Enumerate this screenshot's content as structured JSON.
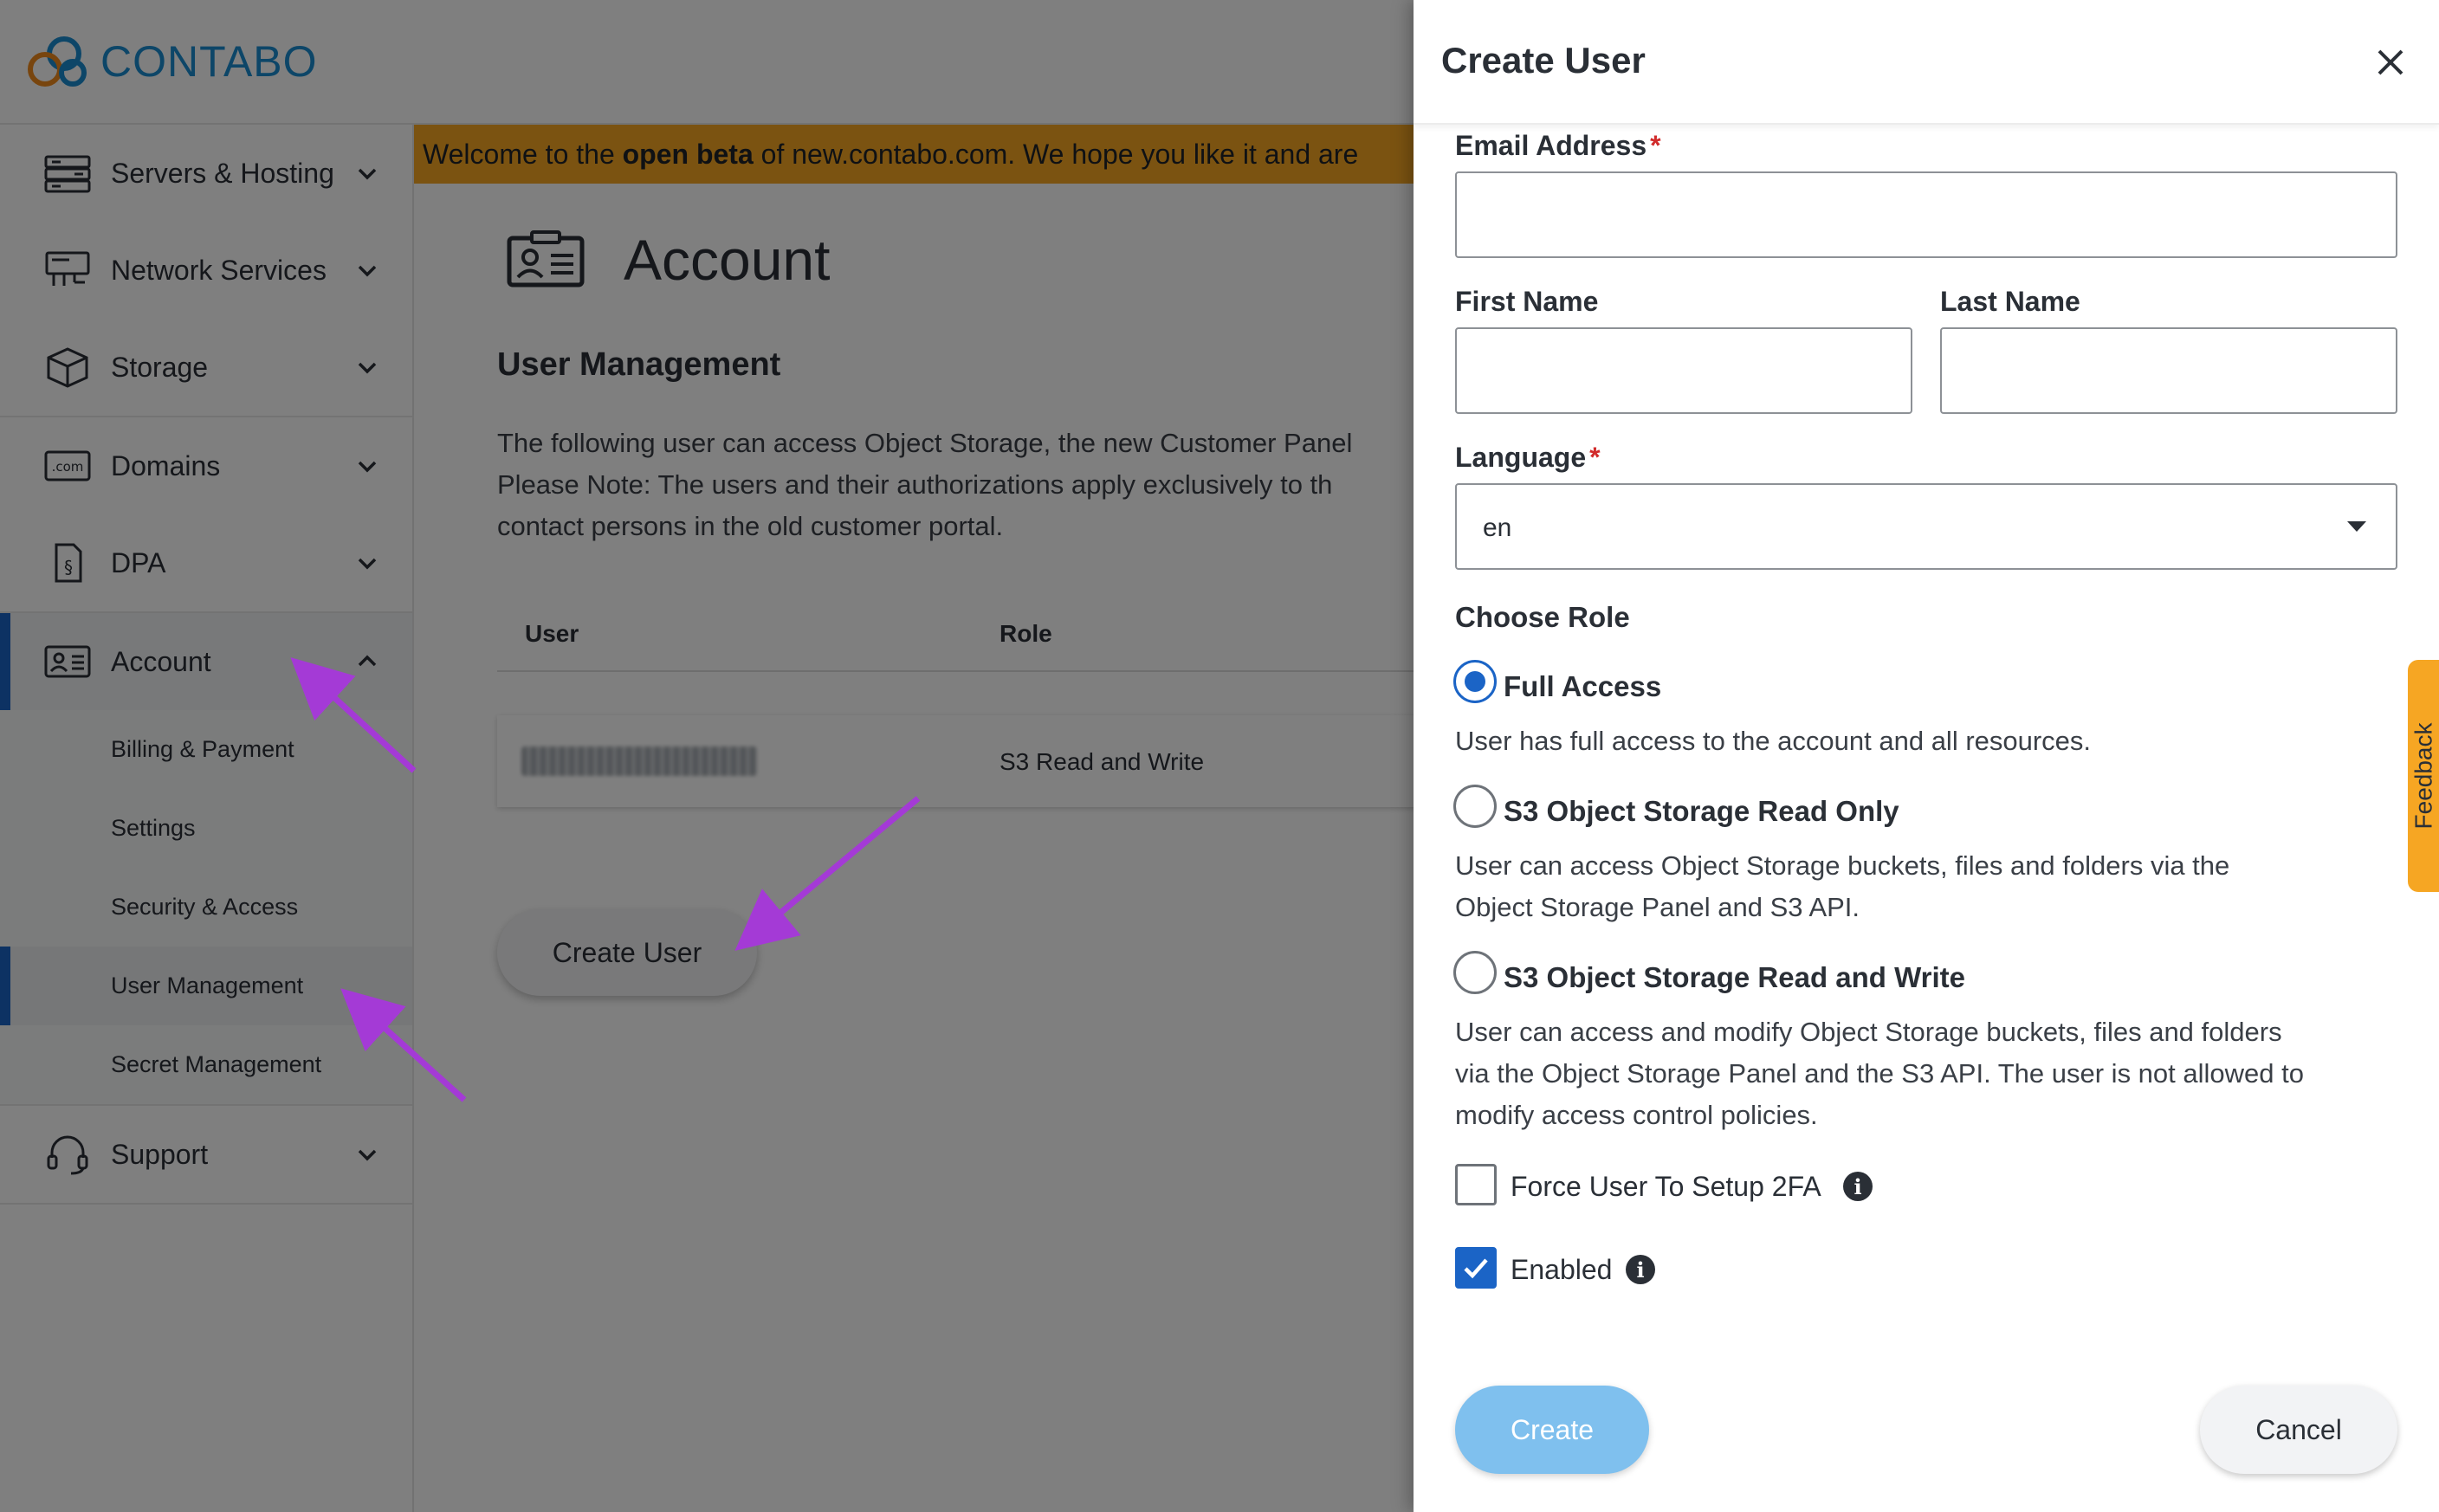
{
  "brand": {
    "name": "CONTABO",
    "color": "#1b8dd1"
  },
  "sidebar": {
    "groups": [
      {
        "label": "Servers & Hosting",
        "icon": "server-icon"
      },
      {
        "label": "Network Services",
        "icon": "network-icon"
      },
      {
        "label": "Storage",
        "icon": "box-icon"
      },
      {
        "label": "Domains",
        "icon": "domain-com-icon"
      },
      {
        "label": "DPA",
        "icon": "document-paragraph-icon"
      },
      {
        "label": "Account",
        "icon": "id-card-icon"
      },
      {
        "label": "Support",
        "icon": "headset-icon"
      }
    ],
    "account_sub": [
      "Billing & Payment",
      "Settings",
      "Security & Access",
      "User Management",
      "Secret Management"
    ]
  },
  "banner": {
    "pre": "Welcome to the ",
    "bold": "open beta",
    "post": " of new.contabo.com. We hope you like it and are"
  },
  "main": {
    "title": "Account",
    "section_title": "User Management",
    "description": [
      "The following user can access Object Storage, the new Customer Panel",
      "Please Note: The users and their authorizations apply exclusively to th",
      "contact persons in the old customer portal."
    ],
    "table": {
      "headers": [
        "User",
        "Role"
      ],
      "rows": [
        {
          "role": "S3 Read and Write"
        }
      ]
    },
    "create_button": "Create User"
  },
  "drawer": {
    "title": "Create User",
    "email_label": "Email Address",
    "first_name_label": "First Name",
    "last_name_label": "Last Name",
    "language_label": "Language",
    "language_value": "en",
    "required_mark": "*",
    "role_title": "Choose Role",
    "roles": [
      {
        "label": "Full Access",
        "selected": true,
        "desc": [
          "User has full access to the account and all resources."
        ]
      },
      {
        "label": "S3 Object Storage Read Only",
        "selected": false,
        "desc": [
          "User can access Object Storage buckets, files and folders via the",
          "Object Storage Panel and S3 API."
        ]
      },
      {
        "label": "S3 Object Storage Read and Write",
        "selected": false,
        "desc": [
          "User can access and modify Object Storage buckets, files and folders",
          "via the Object Storage Panel and the S3 API. The user is not allowed to",
          "modify access control policies."
        ]
      }
    ],
    "force_2fa": {
      "label": "Force User To Setup 2FA",
      "checked": false
    },
    "enabled": {
      "label": "Enabled",
      "checked": true
    },
    "info_glyph": "i",
    "create_label": "Create",
    "cancel_label": "Cancel"
  },
  "feedback_label": "Feedback",
  "colors": {
    "accent": "#1b64c6",
    "banner": "#f6a623",
    "create_button": "#7fc0ee",
    "annotation_arrow": "#a43ad6"
  }
}
